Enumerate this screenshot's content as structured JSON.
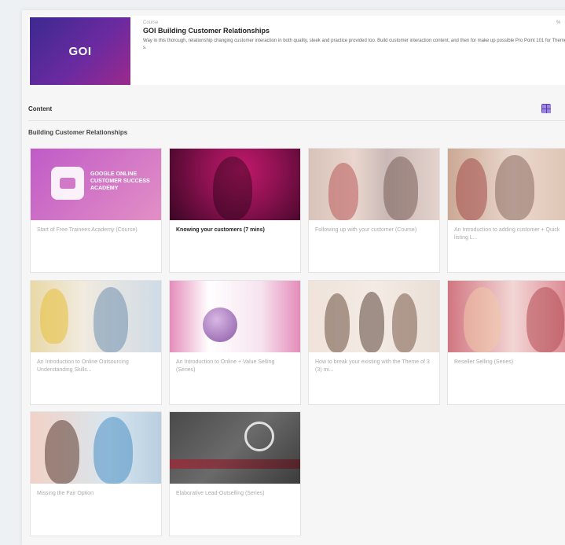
{
  "header": {
    "logo_text": "GOI",
    "kicker": "Course",
    "title": "GOI Building Customer Relationships",
    "description": "Way in this thorough, relationship changing customer interaction in both quality, sleek and practice provided too. Build customer interaction content, and then for make up possible Pro Point 101 for Theme s.",
    "badge": "%"
  },
  "content_bar": {
    "label": "Content"
  },
  "section": {
    "title": "Building Customer Relationships"
  },
  "cards": [
    {
      "title": "Start of Free Trainees Academy (Course)",
      "thumb_text": "GOOGLE ONLINE CUSTOMER SUCCESS ACADEMY"
    },
    {
      "title": "Knowing your customers (7 mins)"
    },
    {
      "title": "Following up with your customer (Course)"
    },
    {
      "title": "An Introduction to adding customer + Quick listing L..."
    },
    {
      "title": "An Introduction to Online Outsourcing Understanding Skills..."
    },
    {
      "title": "An Introduction to Online + Value Selling (Series)"
    },
    {
      "title": "How to break your existing with the Theme of 3 (3) mi..."
    },
    {
      "title": "Reseller Selling (Series)"
    },
    {
      "title": "Missing the Fair Option"
    },
    {
      "title": "Elaborative Lead-Outselling (Series)"
    }
  ],
  "colors": {
    "accent": "#5b3ab0",
    "logo_gradient_start": "#3b2a8f",
    "logo_gradient_end": "#9b2a8c"
  }
}
